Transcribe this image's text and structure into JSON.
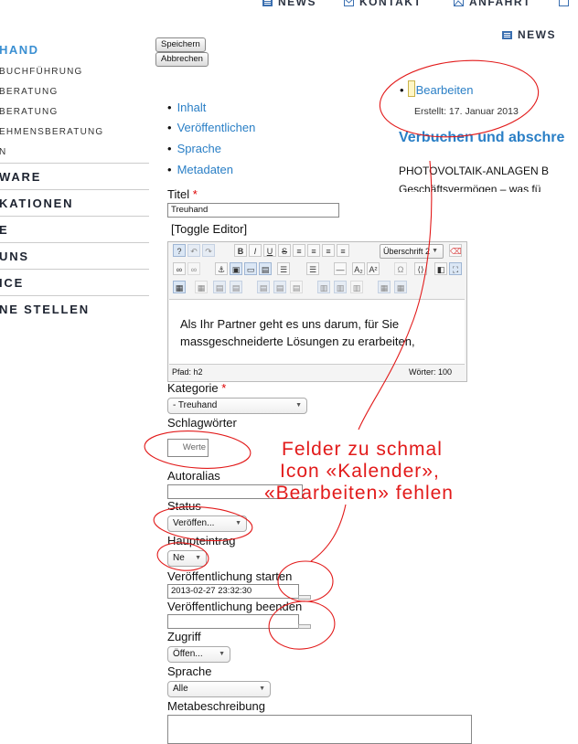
{
  "topnav": {
    "items": [
      {
        "label": "NEWS",
        "icon": "news-icon"
      },
      {
        "label": "KONTAKT",
        "icon": "mail-icon"
      },
      {
        "label": "ANFAHRT",
        "icon": "map-icon"
      }
    ],
    "sub_news": "NEWS"
  },
  "sidebar": {
    "active": "HAND",
    "subitems": [
      "BUCHFÜHRUNG",
      "BERATUNG",
      "BERATUNG",
      "EHMENSBERATUNG",
      "N"
    ],
    "main": [
      "WARE",
      "KATIONEN",
      "E",
      "UNS",
      "ICE",
      "NE STELLEN"
    ]
  },
  "buttons": {
    "save": "Speichern",
    "cancel": "Abbrechen"
  },
  "tabs": [
    "Inhalt",
    "Veröffentlichen",
    "Sprache",
    "Metadaten"
  ],
  "form": {
    "title_label": "Titel",
    "required_mark": "*",
    "title_value": "Treuhand",
    "toggle_editor": "[Toggle Editor]",
    "heading_select": "Überschrift 2",
    "editor_text": "Als Ihr Partner geht es uns darum, für Sie massgeschneiderte Lösungen zu erarbeiten,",
    "path_label": "Pfad:  h2",
    "word_count": "Wörter: 100",
    "category_label": "Kategorie",
    "category_value": "- Treuhand",
    "tags_label": "Schlagwörter",
    "tags_placeholder": "Werte",
    "alias_label": "Autoralias",
    "status_label": "Status",
    "status_value": "Veröffen...",
    "featured_label": "Haupteintrag",
    "featured_value": "Ne",
    "publish_up_label": "Veröffentlichung starten",
    "publish_up_value": "2013-02-27 23:32:30",
    "publish_down_label": "Veröffentlichung beenden",
    "publish_down_value": "",
    "access_label": "Zugriff",
    "access_value": "Öffen...",
    "language_label": "Sprache",
    "language_value": "Alle",
    "metadesc_label": "Metabeschreibung"
  },
  "right": {
    "edit_link": "Bearbeiten",
    "created": "Erstellt: 17. Januar 2013",
    "article_title": "Verbuchen und abschre",
    "article_line1": "PHOTOVOLTAIK-ANLAGEN B",
    "article_line2": "Geschäftsvermögen – was fü"
  },
  "annotation": {
    "lines": [
      "Felder zu schmal",
      "Icon «Kalender»,",
      "«Bearbeiten» fehlen"
    ],
    "color": "#e21a1a"
  }
}
